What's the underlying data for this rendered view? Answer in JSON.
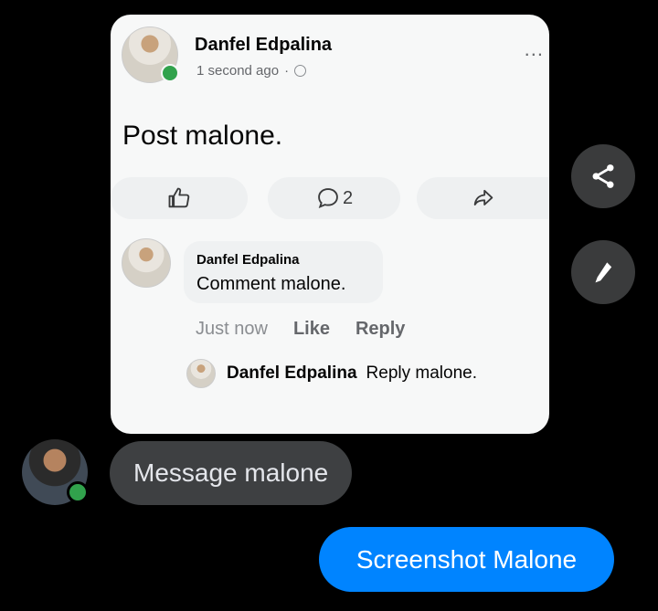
{
  "post": {
    "author": "Danfel Edpalina",
    "timestamp": "1 second ago",
    "separator": "·",
    "privacy_icon": "globe-icon",
    "more_label": "...",
    "text": "Post malone.",
    "actions": {
      "like_icon": "thumbs-up-icon",
      "comment_icon": "comment-icon",
      "comment_count": "2",
      "share_icon": "share-arrow-icon"
    }
  },
  "comment": {
    "author": "Danfel Edpalina",
    "text": "Comment malone.",
    "time": "Just now",
    "like_label": "Like",
    "reply_label": "Reply"
  },
  "reply": {
    "author": "Danfel Edpalina",
    "text": "Reply malone."
  },
  "side_buttons": {
    "share_icon": "share-icon",
    "edit_icon": "pencil-icon"
  },
  "messages": {
    "incoming": "Message malone",
    "outgoing": "Screenshot Malone"
  },
  "colors": {
    "background": "#000000",
    "card": "#f7f8f8",
    "online": "#31a24c",
    "outgoing_bubble": "#0084ff",
    "incoming_bubble": "#3e4042"
  }
}
